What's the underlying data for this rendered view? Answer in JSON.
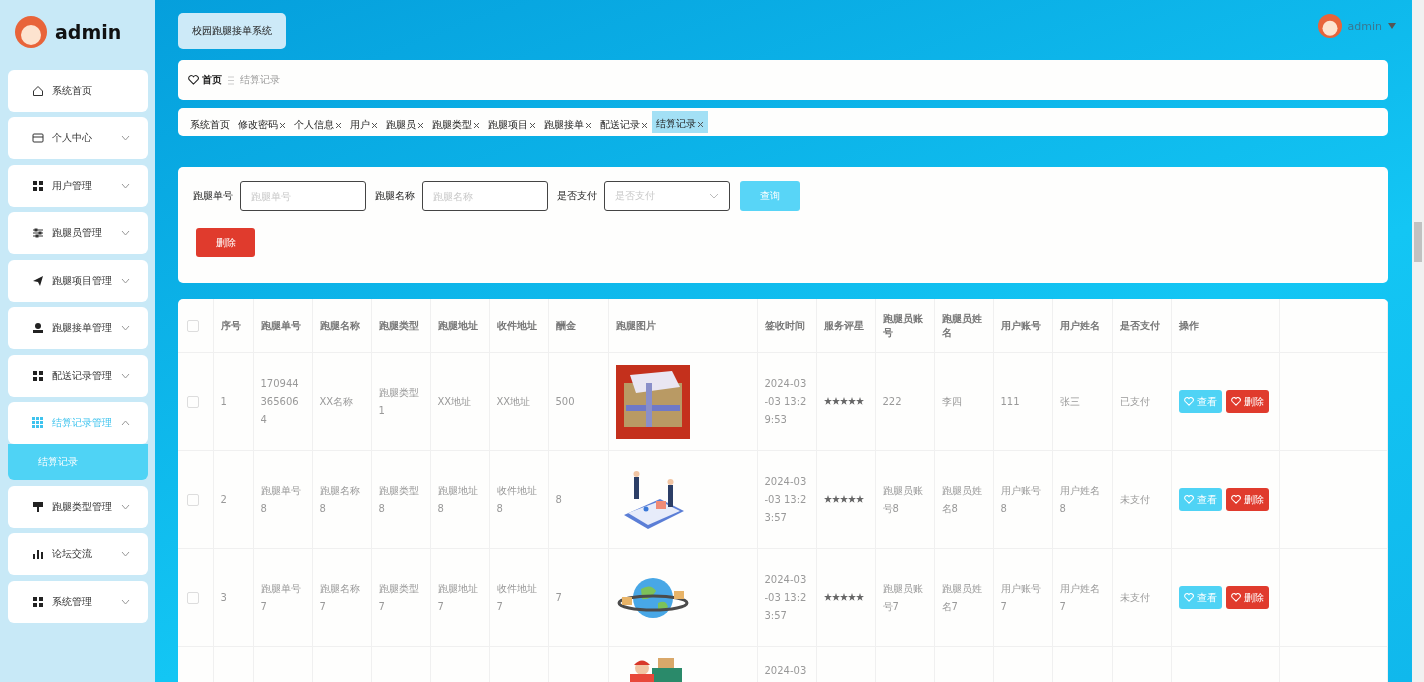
{
  "sidebar": {
    "user": "admin",
    "items": [
      {
        "label": "系统首页",
        "expandable": false,
        "expanded": false
      },
      {
        "label": "个人中心",
        "expandable": true,
        "expanded": false
      },
      {
        "label": "用户管理",
        "expandable": true,
        "expanded": false
      },
      {
        "label": "跑腿员管理",
        "expandable": true,
        "expanded": false
      },
      {
        "label": "跑腿项目管理",
        "expandable": true,
        "expanded": false
      },
      {
        "label": "跑腿接单管理",
        "expandable": true,
        "expanded": false
      },
      {
        "label": "配送记录管理",
        "expandable": true,
        "expanded": false
      },
      {
        "label": "结算记录管理",
        "expandable": true,
        "expanded": true,
        "children": [
          {
            "label": "结算记录",
            "selected": true
          }
        ]
      },
      {
        "label": "跑腿类型管理",
        "expandable": true,
        "expanded": false
      },
      {
        "label": "论坛交流",
        "expandable": true,
        "expanded": false
      },
      {
        "label": "系统管理",
        "expandable": true,
        "expanded": false
      }
    ]
  },
  "header": {
    "title": "校园跑腿接单系统",
    "user": "admin"
  },
  "breadcrumb": [
    "首页",
    "结算记录"
  ],
  "tabs": [
    {
      "label": "系统首页",
      "closable": false,
      "selected": false
    },
    {
      "label": "修改密码",
      "closable": true,
      "selected": false
    },
    {
      "label": "个人信息",
      "closable": true,
      "selected": false
    },
    {
      "label": "用户",
      "closable": true,
      "selected": false
    },
    {
      "label": "跑腿员",
      "closable": true,
      "selected": false
    },
    {
      "label": "跑腿类型",
      "closable": true,
      "selected": false
    },
    {
      "label": "跑腿项目",
      "closable": true,
      "selected": false
    },
    {
      "label": "跑腿接单",
      "closable": true,
      "selected": false
    },
    {
      "label": "配送记录",
      "closable": true,
      "selected": false
    },
    {
      "label": "结算记录",
      "closable": true,
      "selected": true
    }
  ],
  "search": {
    "fields": [
      {
        "kind": "input",
        "label": "跑腿单号",
        "placeholder": "跑腿单号"
      },
      {
        "kind": "input",
        "label": "跑腿名称",
        "placeholder": "跑腿名称"
      },
      {
        "kind": "select",
        "label": "是否支付",
        "placeholder": "是否支付"
      }
    ],
    "query_button": "查询",
    "delete_button": "删除"
  },
  "table": {
    "columns": [
      "序号",
      "跑腿单号",
      "跑腿名称",
      "跑腿类型",
      "跑腿地址",
      "收件地址",
      "酬金",
      "跑腿图片",
      "签收时间",
      "服务评星",
      "跑腿员账号",
      "跑腿员姓名",
      "用户账号",
      "用户姓名",
      "是否支付",
      "操作"
    ],
    "all_checked": false,
    "rows": [
      {
        "checked": false,
        "index": "1",
        "order_no": "1709443656064",
        "name": "XX名称",
        "type": "跑腿类型1",
        "address": "XX地址",
        "recv_address": "XX地址",
        "reward": "500",
        "picture": {
          "kind": "picture"
        },
        "time": "2024-03-03 13:29:53",
        "stars": 5,
        "runner_account": "222",
        "runner_name": "李四",
        "user_account": "111",
        "user_name": "张三",
        "paid": "已支付",
        "actions": [
          {
            "kind": "view",
            "label": "查看"
          },
          {
            "kind": "delete",
            "label": "删除"
          }
        ]
      },
      {
        "checked": false,
        "index": "2",
        "order_no": "跑腿单号8",
        "name": "跑腿名称8",
        "type": "跑腿类型8",
        "address": "跑腿地址8",
        "recv_address": "收件地址8",
        "reward": "8",
        "picture": {
          "kind": "picture"
        },
        "time": "2024-03-03 13:23:57",
        "stars": 5,
        "runner_account": "跑腿员账号8",
        "runner_name": "跑腿员姓名8",
        "user_account": "用户账号8",
        "user_name": "用户姓名8",
        "paid": "未支付",
        "actions": [
          {
            "kind": "view",
            "label": "查看"
          },
          {
            "kind": "delete",
            "label": "删除"
          }
        ]
      },
      {
        "checked": false,
        "index": "3",
        "order_no": "跑腿单号7",
        "name": "跑腿名称7",
        "type": "跑腿类型7",
        "address": "跑腿地址7",
        "recv_address": "收件地址7",
        "reward": "7",
        "picture": {
          "kind": "picture"
        },
        "time": "2024-03-03 13:23:57",
        "stars": 5,
        "runner_account": "跑腿员账号7",
        "runner_name": "跑腿员姓名7",
        "user_account": "用户账号7",
        "user_name": "用户姓名7",
        "paid": "未支付",
        "actions": [
          {
            "kind": "view",
            "label": "查看"
          },
          {
            "kind": "delete",
            "label": "删除"
          }
        ]
      },
      {
        "picture": {
          "kind": "picture"
        },
        "time": "2024-03"
      }
    ]
  }
}
